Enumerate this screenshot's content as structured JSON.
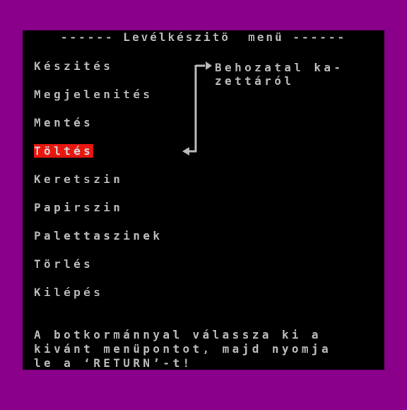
{
  "header": {
    "title": "------ Levélkészitö  menü ------"
  },
  "menu": {
    "items": [
      {
        "label": "Készités"
      },
      {
        "label": "Megjelenités"
      },
      {
        "label": "Mentés"
      },
      {
        "label": "Töltés",
        "selected": true
      },
      {
        "label": "Keretszin"
      },
      {
        "label": "Papirszin"
      },
      {
        "label": "Palettaszinek"
      },
      {
        "label": "Törlés"
      },
      {
        "label": "Kilépés"
      }
    ]
  },
  "side_note": {
    "line1": "Behozatal ka-",
    "line2": "zettáról"
  },
  "help": {
    "line1": "A botkormánnyal válassza ki a",
    "line2": "kivánt menüpontot, majd nyomja",
    "line3": "le a ‘RETURN’-t!"
  },
  "colors": {
    "border": "#8b008b",
    "screen": "#000000",
    "text": "#bdbdbd",
    "highlight": "#e8160f"
  },
  "icons": {
    "arrow": "bent-arrow-icon"
  }
}
